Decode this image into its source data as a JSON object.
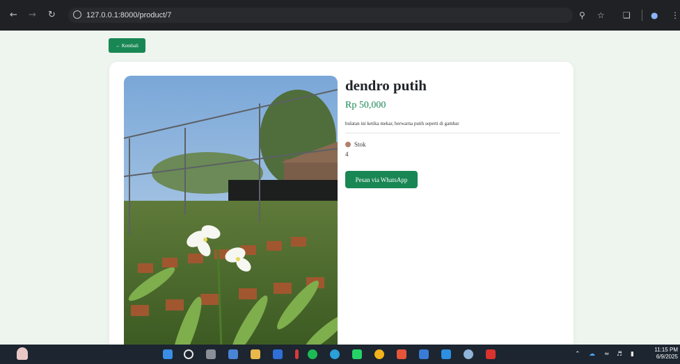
{
  "browser": {
    "url": "127.0.0.1:8000/product/7",
    "icons": [
      "back-icon",
      "forward-icon",
      "reload-icon",
      "site-info-icon",
      "zoom-icon",
      "bookmark-star-icon",
      "extensions-icon",
      "profile-icon",
      "menu-icon"
    ]
  },
  "page": {
    "back_label": "← Kembali",
    "product": {
      "name": "dendro putih",
      "price": "Rp 50,000",
      "description": "bulatan ini ketika mekar, berwarna putih seperti di gambar",
      "stock_label": "Stok",
      "stock_value": "4"
    },
    "whatsapp_label": "Pesan via WhatsApp"
  },
  "taskbar": {
    "time": "11:15 PM",
    "date": "6/9/2025",
    "apps": [
      "start-icon",
      "search-icon",
      "task-view-icon",
      "widgets-icon",
      "file-explorer-icon",
      "folder-icon",
      "app-icon",
      "spotify-icon",
      "edge-icon",
      "whatsapp-icon",
      "chrome-icon",
      "app-icon",
      "app-icon",
      "vscode-icon",
      "settings-icon",
      "wps-icon"
    ]
  },
  "colors": {
    "accent": "#198754",
    "page_bg": "#eef4ee",
    "chrome_bg": "#202124",
    "taskbar_bg": "#1c2530"
  }
}
